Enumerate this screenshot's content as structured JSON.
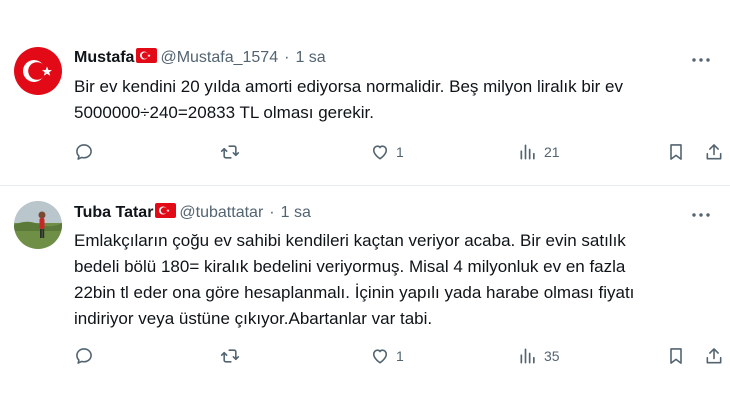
{
  "tweets": [
    {
      "author": "Mustafa",
      "handle": "@Mustafa_1574",
      "separator": "·",
      "time": "1 sa",
      "text_lines": [
        "Bir ev kendini 20 yılda amorti ediyorsa normalidir. Beş milyon liralık bir ev",
        "5000000÷240=20833 TL olması gerekir."
      ],
      "likes": "1",
      "views": "21"
    },
    {
      "author": "Tuba Tatar",
      "handle": "@tubattatar",
      "separator": "·",
      "time": "1 sa",
      "text_lines": [
        "Emlakçıların çoğu ev sahibi kendileri kaçtan veriyor acaba. Bir evin satılık",
        "bedeli bölü 180= kiralık bedelini veriyormuş. Misal 4 milyonluk ev en fazla",
        "22bin tl eder ona göre hesaplanmalı. İçinin yapılı yada harabe olması fiyatı",
        "indiriyor veya üstüne çıkıyor.Abartanlar var tabi."
      ],
      "likes": "1",
      "views": "35"
    }
  ],
  "icons": {
    "flag": "turkey-flag-icon",
    "more": "more-icon",
    "reply": "reply-icon",
    "retweet": "retweet-icon",
    "like": "like-icon",
    "views": "views-icon",
    "bookmark": "bookmark-icon",
    "share": "share-icon"
  },
  "colors": {
    "text": "#0f1419",
    "secondary": "#536471",
    "flag_red": "#e30a17",
    "divider": "#e6ecf0"
  }
}
